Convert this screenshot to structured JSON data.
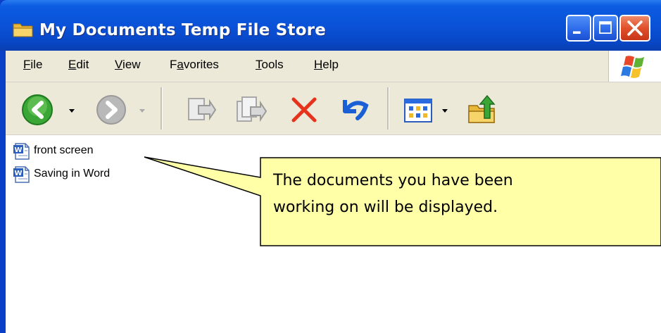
{
  "window": {
    "title": "My Documents Temp File Store",
    "title_icon": "folder-icon",
    "controls": [
      "minimize-icon",
      "maximize-icon",
      "close-icon"
    ]
  },
  "menubar": {
    "items": [
      {
        "label": "File",
        "accel": "F",
        "rest": "ile"
      },
      {
        "label": "Edit",
        "accel": "E",
        "rest": "dit"
      },
      {
        "label": "View",
        "accel": "V",
        "rest": "iew"
      },
      {
        "label": "Favorites",
        "pre": "F",
        "accel": "a",
        "rest": "vorites"
      },
      {
        "label": "Tools",
        "accel": "T",
        "rest": "ools"
      },
      {
        "label": "Help",
        "accel": "H",
        "rest": "elp"
      }
    ],
    "logo": "windows-logo-icon"
  },
  "toolbar": {
    "buttons": [
      "back-icon",
      "forward-icon",
      "move-to-icon",
      "copy-to-icon",
      "delete-icon",
      "undo-icon",
      "views-icon",
      "folder-up-icon"
    ]
  },
  "files": [
    {
      "name": "front screen",
      "icon": "word-document-icon"
    },
    {
      "name": "Saving in Word",
      "icon": "word-document-icon"
    }
  ],
  "callout": {
    "line1": "The documents you have been",
    "line2": "working on will be displayed."
  },
  "colors": {
    "titlebar": "#0a52d8",
    "chrome": "#ece9d8",
    "callout_fill": "#ffffa8",
    "delete_red": "#e8331c",
    "undo_blue": "#1b5fd6"
  }
}
